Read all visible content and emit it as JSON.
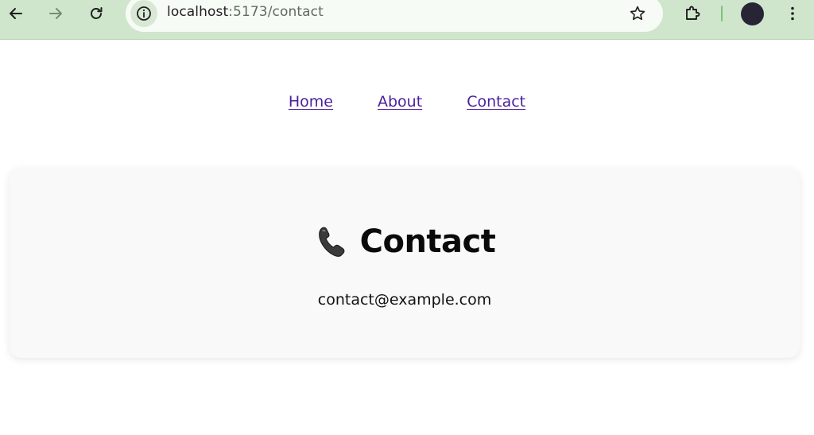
{
  "browser": {
    "url_host": "localhost",
    "url_path": ":5173/contact",
    "icons": {
      "back": "arrow-left-icon",
      "forward": "arrow-right-icon",
      "reload": "reload-icon",
      "site_info": "info-icon",
      "bookmark": "star-icon",
      "extensions": "puzzle-icon",
      "menu": "kebab-menu-icon"
    },
    "colors": {
      "toolbar": "#cfe6cc",
      "omnibox": "#f7fbf6"
    }
  },
  "nav": {
    "links": [
      {
        "label": "Home"
      },
      {
        "label": "About"
      },
      {
        "label": "Contact"
      }
    ],
    "link_color": "#4a1f9e"
  },
  "card": {
    "icon": "telephone-icon",
    "title": "Contact",
    "email": "contact@example.com"
  }
}
